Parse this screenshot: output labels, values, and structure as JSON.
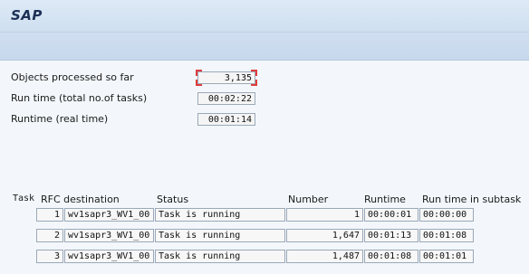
{
  "header": {
    "title": "SAP"
  },
  "stats": [
    {
      "label": "Objects processed so far",
      "value": "3,135"
    },
    {
      "label": "Run time (total no.of tasks)",
      "value": "00:02:22"
    },
    {
      "label": "Runtime (real time)",
      "value": "00:01:14"
    }
  ],
  "table": {
    "headers": [
      "Task",
      "RFC destination",
      "Status",
      "Number",
      "Runtime",
      "Run time in subtask"
    ],
    "rows": [
      {
        "task": "1",
        "rfc": "wv1sapr3_WV1_00",
        "status": "Task is running",
        "number": "1",
        "runtime": "00:00:01",
        "subtask": "00:00:00"
      },
      {
        "task": "2",
        "rfc": "wv1sapr3_WV1_00",
        "status": "Task is running",
        "number": "1,647",
        "runtime": "00:01:13",
        "subtask": "00:01:08"
      },
      {
        "task": "3",
        "rfc": "wv1sapr3_WV1_00",
        "status": "Task is running",
        "number": "1,487",
        "runtime": "00:01:08",
        "subtask": "00:01:01"
      }
    ]
  }
}
